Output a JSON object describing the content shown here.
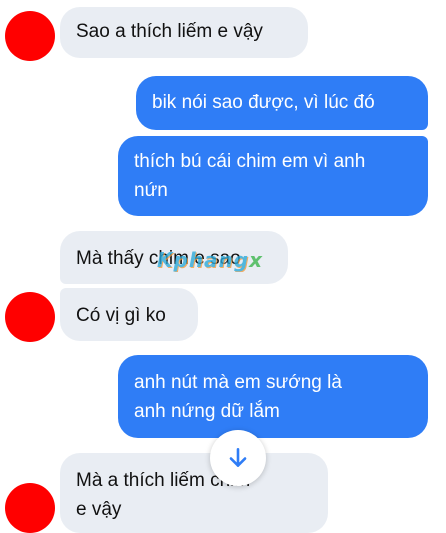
{
  "messages": [
    {
      "side": "in",
      "text": "Sao a thích liếm e vậy"
    },
    {
      "side": "out",
      "text": "bik nói sao được, vì lúc đó"
    },
    {
      "side": "out",
      "line1": "thích bú cái chim em vì anh",
      "line2": "nứn"
    },
    {
      "side": "in",
      "text": "Mà thấy chim e sao"
    },
    {
      "side": "in",
      "text": "Có vị gì ko"
    },
    {
      "side": "out",
      "line1": "anh nút mà em sướng là",
      "line2": "anh nứng dữ lắm"
    },
    {
      "side": "in",
      "line1": "Mà a thích liếm chim",
      "line2": "e vậy"
    }
  ],
  "watermark": {
    "brand": "Kphang",
    "suffix": "x"
  },
  "scroll_button": {
    "icon": "arrow-down-icon"
  },
  "colors": {
    "avatar": "#ff0000",
    "incoming_bubble": "#e9edf3",
    "outgoing_bubble": "#2f7df6",
    "watermark": "#2aa8d8"
  }
}
